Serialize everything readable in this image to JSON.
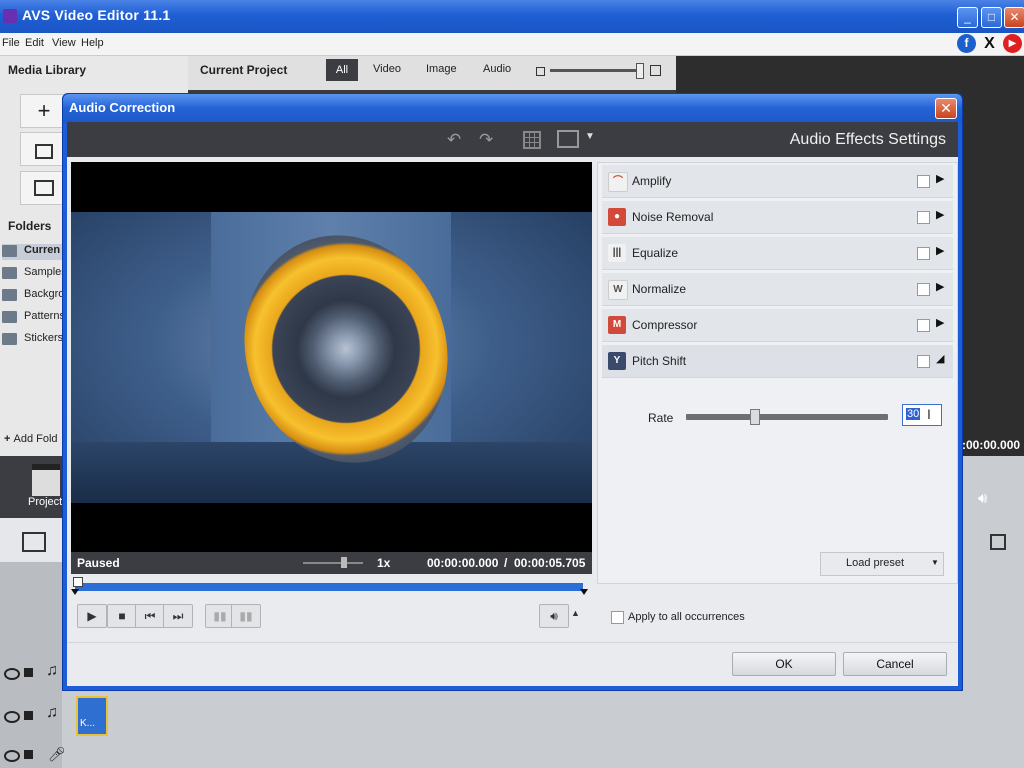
{
  "app": {
    "title": "AVS Video Editor 11.1"
  },
  "menu": [
    "File",
    "Edit",
    "View",
    "Help"
  ],
  "social": {
    "facebook": "f",
    "x": "X",
    "youtube": "▶"
  },
  "left_panel": {
    "header": "Media Library",
    "folders_header": "Folders",
    "folders": [
      "Curren",
      "Samples",
      "Backgro",
      "Patterns",
      "Stickers"
    ],
    "add_folder": "Add Fold",
    "project_label": "Project"
  },
  "project": {
    "header": "Current Project",
    "filters": [
      "All",
      "Video",
      "Image",
      "Audio"
    ]
  },
  "right_time": ":00:00.000",
  "timeline_clip": "K...",
  "dialog": {
    "title": "Audio Correction",
    "header": "Audio Effects Settings",
    "status": "Paused",
    "speed": "1x",
    "current_time": "00:00:00.000",
    "separator": "/",
    "total_time": "00:00:05.705",
    "seek_fraction": 0.0,
    "effects": [
      {
        "name": "Amplify",
        "icon": "amplify-icon",
        "color": "#f1f1f1"
      },
      {
        "name": "Noise Removal",
        "icon": "noise-removal-icon",
        "color": "#d24a3a"
      },
      {
        "name": "Equalize",
        "icon": "equalize-icon",
        "color": "#f1f1f1"
      },
      {
        "name": "Normalize",
        "icon": "normalize-icon",
        "color": "#f1f1f1"
      },
      {
        "name": "Compressor",
        "icon": "compressor-icon",
        "color": "#d24a3a"
      },
      {
        "name": "Pitch Shift",
        "icon": "pitch-shift-icon",
        "color": "#3a4a6a"
      }
    ],
    "rate": {
      "label": "Rate",
      "value": "30",
      "slider_fraction": 0.33
    },
    "load_preset": "Load preset",
    "apply_all": "Apply to all occurrences",
    "ok": "OK",
    "cancel": "Cancel"
  }
}
